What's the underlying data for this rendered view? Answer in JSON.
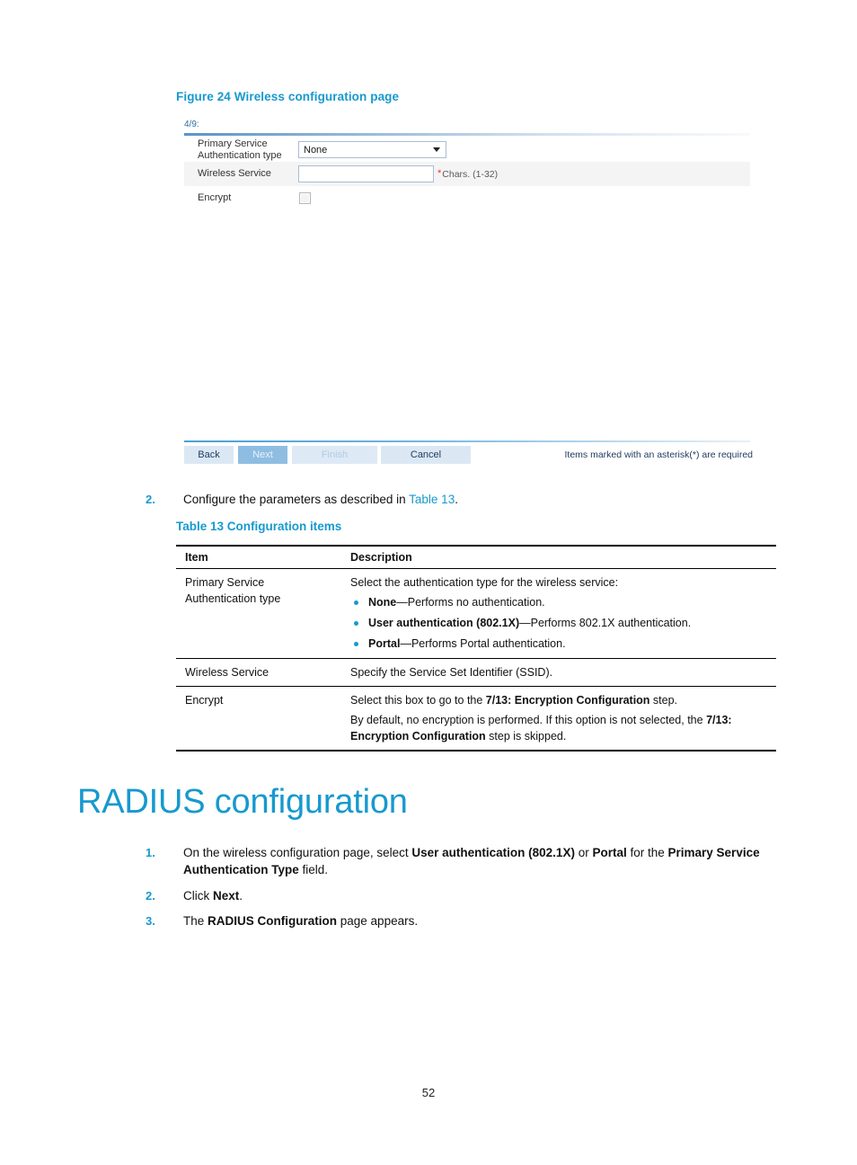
{
  "figure": {
    "caption": "Figure 24 Wireless configuration page",
    "step_label": "4/9:",
    "rows": [
      {
        "label": "Primary Service Authentication type",
        "control": "dropdown",
        "value": "None"
      },
      {
        "label": "Wireless Service",
        "control": "text",
        "value": "",
        "required_mark": "*",
        "hint": "Chars. (1-32)"
      },
      {
        "label": "Encrypt",
        "control": "checkbox",
        "checked": false
      }
    ],
    "buttons": {
      "back": "Back",
      "next": "Next",
      "finish": "Finish",
      "cancel": "Cancel"
    },
    "required_note": "Items marked with an asterisk(*) are required"
  },
  "step_table_ref": {
    "number": "2.",
    "text_before": "Configure the parameters as described in ",
    "xref": "Table 13",
    "text_after": "."
  },
  "table": {
    "caption": "Table 13 Configuration items",
    "headers": {
      "item": "Item",
      "description": "Description"
    },
    "rows": [
      {
        "item": "Primary Service Authentication type",
        "intro": "Select the authentication type for the wireless service:",
        "bullets": [
          {
            "term": "None",
            "rest": "—Performs no authentication."
          },
          {
            "term": "User authentication (802.1X)",
            "rest": "—Performs 802.1X authentication."
          },
          {
            "term": "Portal",
            "rest": "—Performs Portal authentication."
          }
        ]
      },
      {
        "item": "Wireless Service",
        "desc": "Specify the Service Set Identifier (SSID)."
      },
      {
        "item": "Encrypt",
        "para1_a": "Select this box to go to the ",
        "para1_b": "7/13: Encryption Configuration",
        "para1_c": " step.",
        "para2_a": "By default, no encryption is performed. If this option is not selected, the ",
        "para2_b": "7/13: Encryption Configuration",
        "para2_c": " step is skipped."
      }
    ]
  },
  "heading": "RADIUS configuration",
  "radius_steps": [
    {
      "number": "1.",
      "a": "On the wireless configuration page, select ",
      "b1": "User authentication (802.1X)",
      "c": " or ",
      "b2": "Portal",
      "d": " for the ",
      "b3": "Primary Service Authentication Type",
      "e": " field."
    },
    {
      "number": "2.",
      "a": "Click ",
      "b1": "Next",
      "c": "."
    },
    {
      "number": "3.",
      "a": "The ",
      "b1": "RADIUS Configuration",
      "c": " page appears."
    }
  ],
  "page_number": "52",
  "colors": {
    "accent_blue": "#1799ce",
    "required_red": "#e8352a"
  }
}
